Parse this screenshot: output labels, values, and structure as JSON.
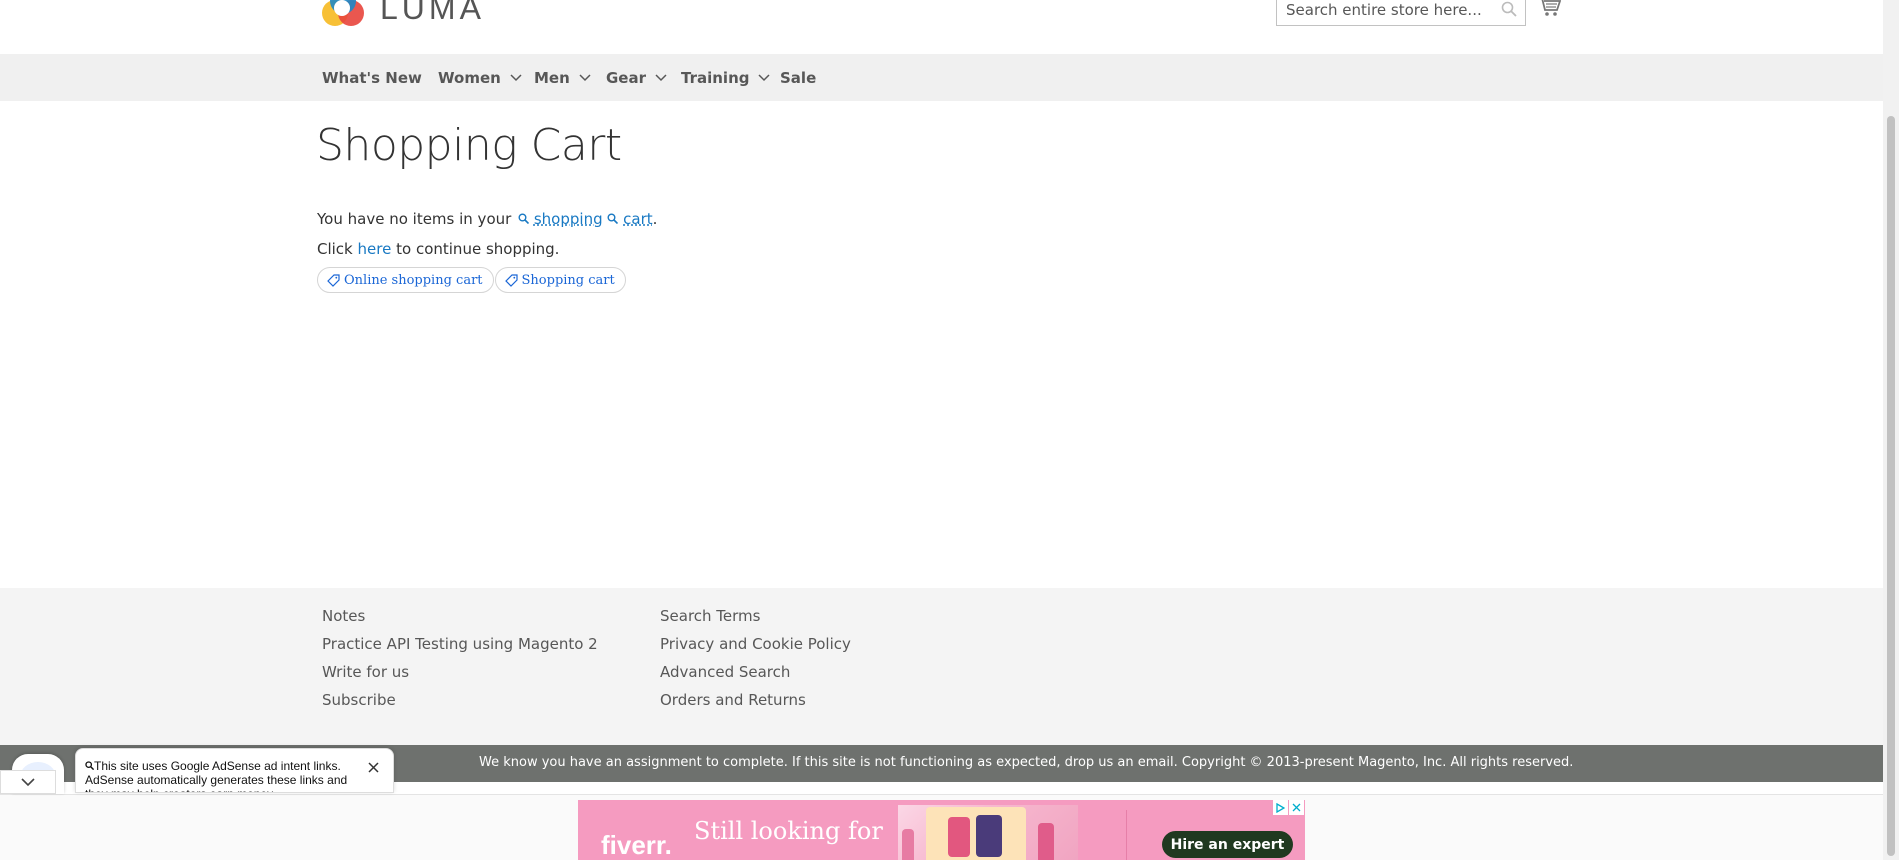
{
  "header": {
    "logo_text": "LUMA",
    "search_placeholder": "Search entire store here...",
    "search_icon": "search-icon",
    "cart_icon": "cart-icon"
  },
  "nav": {
    "items": [
      {
        "label": "What's New",
        "has_dropdown": false
      },
      {
        "label": "Women",
        "has_dropdown": true
      },
      {
        "label": "Men",
        "has_dropdown": true
      },
      {
        "label": "Gear",
        "has_dropdown": true
      },
      {
        "label": "Training",
        "has_dropdown": true
      },
      {
        "label": "Sale",
        "has_dropdown": false
      }
    ]
  },
  "main": {
    "title": "Shopping Cart",
    "empty_prefix": "You have no items in your",
    "empty_link1": "shopping",
    "empty_link2": "cart",
    "empty_suffix": ".",
    "continue_prefix": "Click",
    "continue_link": "here",
    "continue_suffix": "to continue shopping.",
    "tags": [
      "Online shopping cart",
      "Shopping cart"
    ]
  },
  "footer": {
    "col1": [
      "Notes",
      "Practice API Testing using Magento 2",
      "Write for us",
      "Subscribe"
    ],
    "col2": [
      "Search Terms",
      "Privacy and Cookie Policy",
      "Advanced Search",
      "Orders and Returns"
    ],
    "copyright": "We know you have an assignment to complete. If this site is not functioning as expected, drop us an email. Copyright © 2013-present Magento, Inc. All rights reserved."
  },
  "ad": {
    "brand": "fiverr.",
    "headline": "Still looking for",
    "cta": "Hire an expert"
  },
  "adsense_popup": {
    "text": "This site uses Google AdSense ad intent links. AdSense automatically generates these links and they may help creators earn money."
  },
  "colors": {
    "link": "#1979c3",
    "nav_bg": "#f0f0f0",
    "footer_bg": "#f4f4f4",
    "copyright_bg": "#6e716e",
    "ad_bg": "#f59bc0",
    "ad_button": "#203920"
  }
}
